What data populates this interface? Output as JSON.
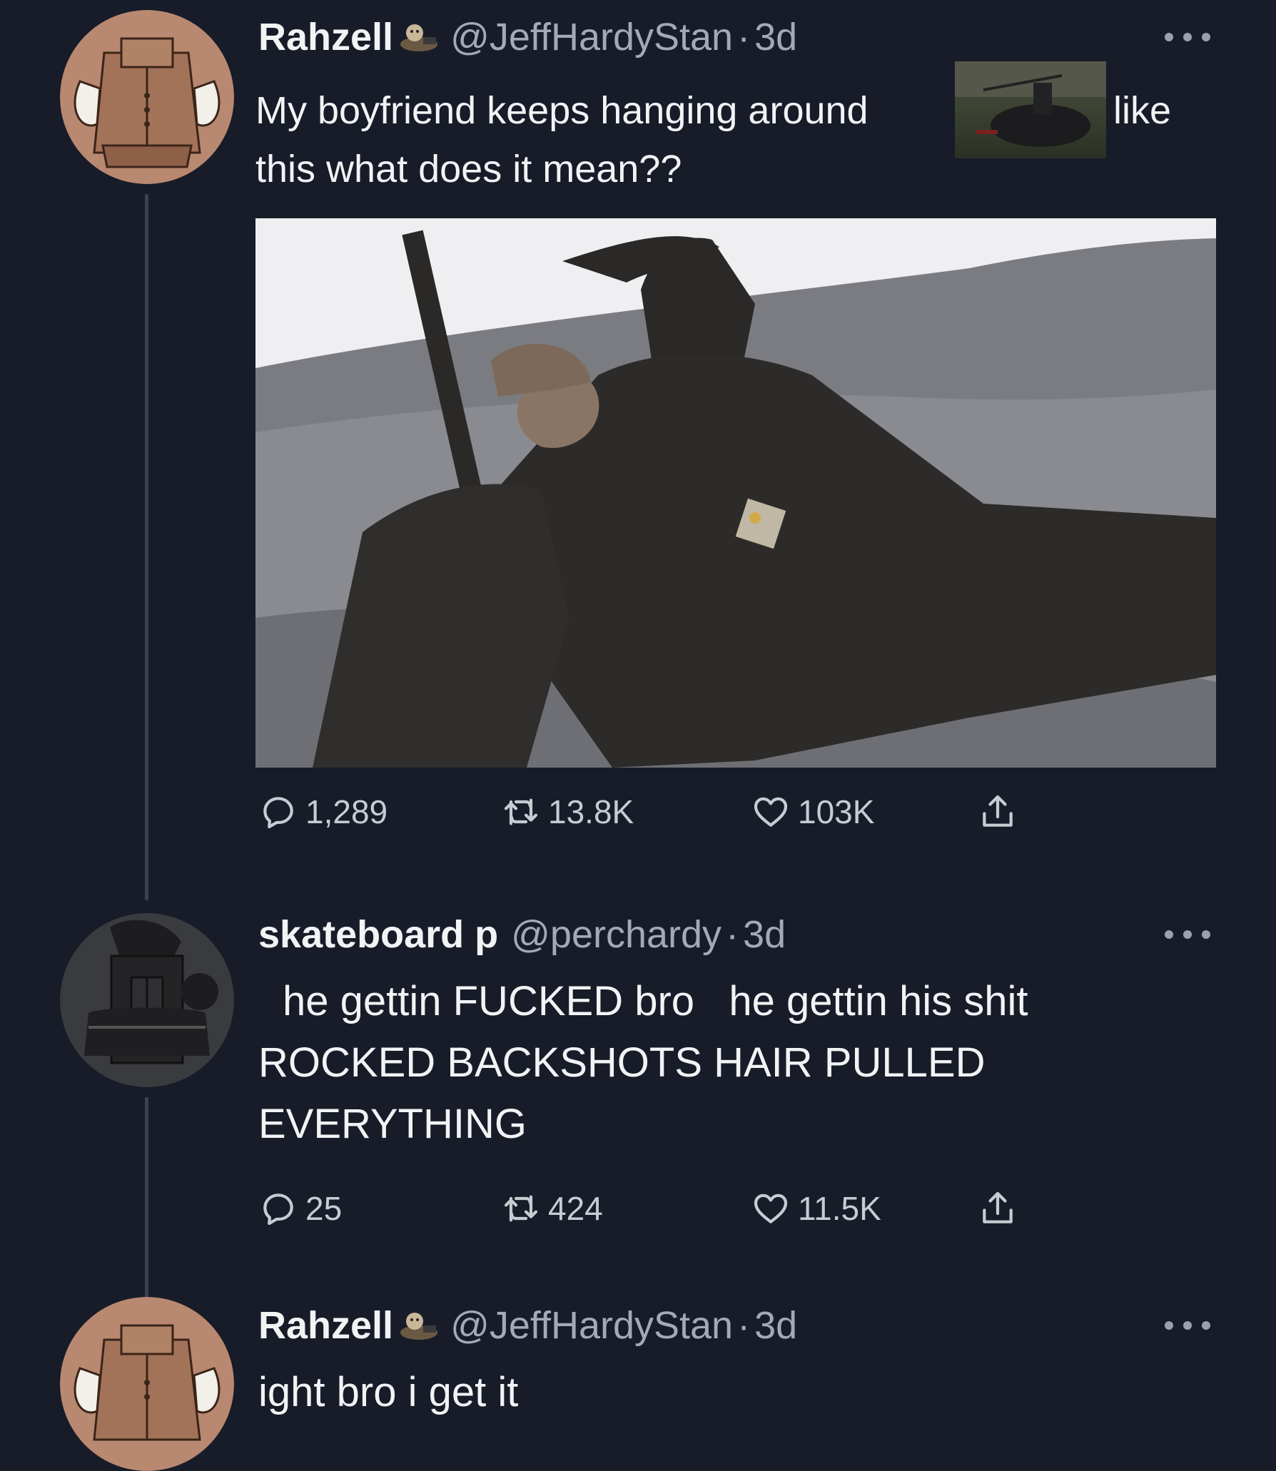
{
  "tweets": [
    {
      "display_name": "Rahzell",
      "handle": "@JeffHardyStan",
      "separator": "·",
      "time": "3d",
      "text_line1": "My boyfriend keeps hanging around",
      "text_inline_after": "like",
      "text_line2": "this what does it mean??",
      "stats": {
        "replies": "1,289",
        "retweets": "13.8K",
        "likes": "103K"
      }
    },
    {
      "display_name": "skateboard p",
      "handle": "@perchardy",
      "separator": "·",
      "time": "3d",
      "text_line1": "he gettin FUCKED bro   he gettin his shit",
      "text_line2": "ROCKED BACKSHOTS HAIR PULLED",
      "text_line3": "EVERYTHING",
      "stats": {
        "replies": "25",
        "retweets": "424",
        "likes": "11.5K"
      }
    },
    {
      "display_name": "Rahzell",
      "handle": "@JeffHardyStan",
      "separator": "·",
      "time": "3d",
      "text_line1": "ight bro i get it"
    }
  ],
  "icons": {
    "reply": "reply-icon",
    "retweet": "retweet-icon",
    "like": "heart-icon",
    "share": "share-icon",
    "more": "more-icon",
    "badge": "mascot-badge-icon"
  },
  "colors": {
    "background": "#171c28",
    "primary_text": "#f2f3f5",
    "secondary_text": "#a3aab5",
    "thread_line": "#3a4150"
  }
}
